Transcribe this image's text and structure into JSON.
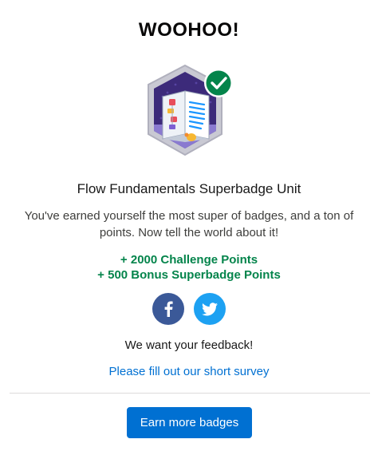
{
  "header": {
    "title": "WOOHOO!"
  },
  "badge": {
    "icon": "superbadge-book-icon",
    "completed_icon": "checkmark-icon",
    "name": "Flow Fundamentals Superbadge Unit"
  },
  "message": "You've earned yourself the most super of badges, and a ton of points. Now tell the world about it!",
  "points": {
    "challenge": "+ 2000 Challenge Points",
    "bonus": "+ 500 Bonus Superbadge Points"
  },
  "share": {
    "facebook_icon": "facebook-icon",
    "twitter_icon": "twitter-icon"
  },
  "feedback": {
    "heading": "We want your feedback!",
    "link_label": "Please fill out our short survey"
  },
  "cta": {
    "label": "Earn more badges"
  },
  "colors": {
    "points_green": "#04844b",
    "link_blue": "#0070d2",
    "facebook_blue": "#3b5998",
    "twitter_blue": "#1da1f2",
    "check_green": "#04844b",
    "badge_purple": "#5a3d91"
  }
}
